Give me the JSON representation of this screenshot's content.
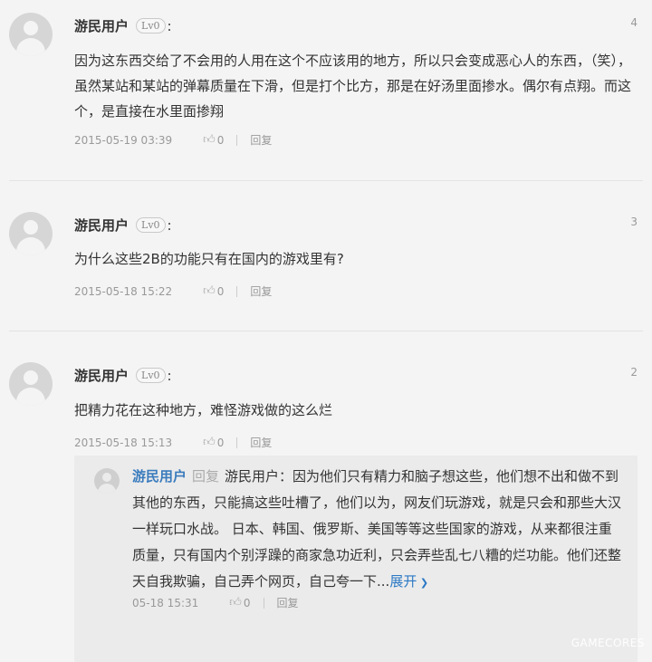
{
  "comments": [
    {
      "username": "游民用户",
      "level": "Lv0",
      "floor": "4",
      "text": "因为这东西交给了不会用的人用在这个不应该用的地方，所以只会变成恶心人的东西，（笑），虽然某站和某站的弹幕质量在下滑，但是打个比方，那是在好汤里面掺水。偶尔有点翔。而这个，是直接在水里面掺翔",
      "date": "2015-05-19 03:39",
      "likes": "0",
      "reply_label": "回复"
    },
    {
      "username": "游民用户",
      "level": "Lv0",
      "floor": "3",
      "text": "为什么这些2B的功能只有在国内的游戏里有?",
      "date": "2015-05-18 15:22",
      "likes": "0",
      "reply_label": "回复"
    },
    {
      "username": "游民用户",
      "level": "Lv0",
      "floor": "2",
      "text": "把精力花在这种地方，难怪游戏做的这么烂",
      "date": "2015-05-18 15:13",
      "likes": "0",
      "reply_label": "回复",
      "reply": {
        "username": "游民用户",
        "reply_word": "回复",
        "target": "游民用户",
        "text": "：因为他们只有精力和脑子想这些，他们想不出和做不到其他的东西，只能搞这些吐槽了，他们以为，网友们玩游戏，就是只会和那些大汉一样玩口水战。 日本、韩国、俄罗斯、美国等等这些国家的游戏，从来都很注重质量，只有国内个别浮躁的商家急功近利，只会弄些乱七八糟的烂功能。他们还整天自我欺骗，自己弄个网页，自己夸一下...",
        "expand_label": "展开",
        "date": "05-18 15:31",
        "likes": "0",
        "reply_label": "回复"
      }
    }
  ],
  "watermark": "GAMECORES",
  "colors": {
    "link": "#2b78c5",
    "reply_name": "#3a7bbd",
    "background": "#f4f4f4"
  }
}
